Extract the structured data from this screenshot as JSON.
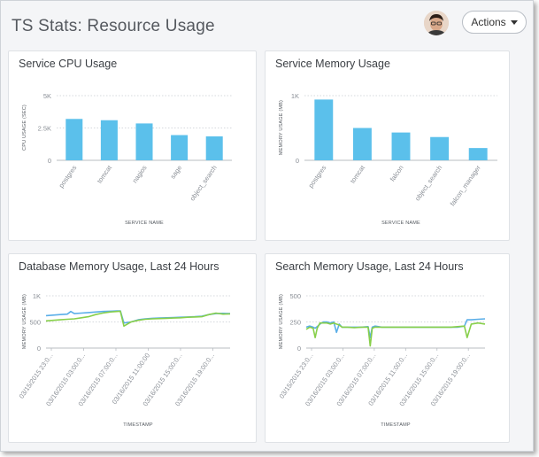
{
  "header": {
    "title": "TS Stats: Resource Usage",
    "actions_label": "Actions"
  },
  "colors": {
    "bar": "#5bc0eb",
    "line_blue": "#5aaee8",
    "line_green": "#87cf4a",
    "grid": "#c8ccd2"
  },
  "icons": {
    "avatar": "user-avatar",
    "actions_caret": "caret-down-icon"
  },
  "chart_data": [
    {
      "type": "bar",
      "title": "Service CPU Usage",
      "xlabel": "SERVICE NAME",
      "ylabel": "CPU USAGE (SEC)",
      "categories": [
        "postgres",
        "tomcat",
        "nagios",
        "sage",
        "object_search"
      ],
      "values": [
        3200,
        3100,
        2850,
        1950,
        1850
      ],
      "ylim": [
        0,
        5000
      ],
      "yticks": [
        {
          "v": 0,
          "label": "0"
        },
        {
          "v": 2500,
          "label": "2.5K"
        },
        {
          "v": 5000,
          "label": "5K"
        }
      ],
      "grid": true
    },
    {
      "type": "bar",
      "title": "Service Memory Usage",
      "xlabel": "SERVICE NAME",
      "ylabel": "MEMORY USAGE (MB)",
      "categories": [
        "postgres",
        "tomcat",
        "falcon",
        "object_search",
        "falcon_manager"
      ],
      "values": [
        940,
        500,
        430,
        360,
        190
      ],
      "ylim": [
        0,
        1000
      ],
      "yticks": [
        {
          "v": 0,
          "label": "0"
        },
        {
          "v": 1000,
          "label": "1K"
        }
      ],
      "grid": true
    },
    {
      "type": "line",
      "title": "Database Memory Usage, Last 24 Hours",
      "xlabel": "TIMESTAMP",
      "ylabel": "MEMORY USAGE (MB)",
      "xticks": [
        "03/15/2015 23:0...",
        "03/16/2015 03:00:0...",
        "03/16/2015 07:00:0...",
        "03/16/2015 11:00:00",
        "03/16/2015 15:00:0...",
        "03/16/2015 19:00:0..."
      ],
      "ylim": [
        0,
        1000
      ],
      "yticks": [
        {
          "v": 0,
          "label": "0"
        },
        {
          "v": 500,
          "label": "500"
        },
        {
          "v": 1000,
          "label": "1K"
        }
      ],
      "xlim": [
        0,
        26
      ],
      "grid": true,
      "series": [
        {
          "color": "#5aaee8",
          "x": [
            0,
            1,
            2,
            3,
            3.5,
            4,
            5,
            6,
            7,
            8,
            9,
            10,
            10.5,
            11,
            12,
            13,
            14,
            15,
            16,
            17,
            18,
            19,
            20,
            21,
            22,
            23,
            24,
            25,
            26
          ],
          "y": [
            620,
            630,
            640,
            650,
            700,
            660,
            670,
            680,
            690,
            700,
            705,
            710,
            712,
            480,
            500,
            540,
            560,
            570,
            575,
            580,
            585,
            590,
            595,
            600,
            610,
            640,
            660,
            665,
            660
          ]
        },
        {
          "color": "#87cf4a",
          "x": [
            0,
            1,
            2,
            3,
            4,
            5,
            6,
            7,
            8,
            9,
            10,
            10.5,
            11,
            12,
            13,
            14,
            15,
            16,
            17,
            18,
            19,
            20,
            21,
            22,
            23,
            24,
            25,
            26
          ],
          "y": [
            520,
            530,
            540,
            550,
            560,
            580,
            600,
            640,
            670,
            690,
            700,
            705,
            420,
            500,
            530,
            550,
            560,
            565,
            570,
            575,
            580,
            590,
            595,
            600,
            640,
            670,
            650,
            655
          ]
        }
      ]
    },
    {
      "type": "line",
      "title": "Search Memory Usage, Last 24 Hours",
      "xlabel": "TIMESTAMP",
      "ylabel": "MEMORY USAGE (MB)",
      "xticks": [
        "03/15/2015 23:0...",
        "03/16/2015 03:00:0...",
        "03/16/2015 07:00:0...",
        "03/16/2015 11:00:0...",
        "03/16/2015 15:00:0...",
        "03/16/2015 19:00:0..."
      ],
      "ylim": [
        0,
        500
      ],
      "yticks": [
        {
          "v": 0,
          "label": "0"
        },
        {
          "v": 250,
          "label": "250"
        },
        {
          "v": 500,
          "label": "500"
        }
      ],
      "xlim": [
        0,
        26
      ],
      "grid": true,
      "series": [
        {
          "color": "#5aaee8",
          "x": [
            0,
            0.5,
            1,
            1.3,
            1.6,
            2,
            2.5,
            3,
            3.5,
            4,
            4.4,
            4.8,
            5.2,
            6,
            7,
            8,
            9,
            9.3,
            9.6,
            10,
            11,
            12,
            13,
            14,
            15,
            16,
            17,
            18,
            19,
            20,
            21,
            22,
            23,
            23.4,
            24,
            25,
            26
          ],
          "y": [
            200,
            210,
            200,
            190,
            205,
            230,
            250,
            250,
            240,
            250,
            150,
            230,
            200,
            200,
            200,
            200,
            205,
            100,
            200,
            210,
            200,
            200,
            200,
            200,
            200,
            200,
            200,
            200,
            200,
            200,
            200,
            200,
            210,
            270,
            270,
            275,
            280
          ]
        },
        {
          "color": "#87cf4a",
          "x": [
            0,
            0.5,
            1,
            1.3,
            1.6,
            2,
            2.5,
            3,
            3.5,
            4,
            4.4,
            4.8,
            5.2,
            6,
            7,
            8,
            9,
            9.3,
            9.6,
            10,
            11,
            12,
            13,
            14,
            15,
            16,
            17,
            18,
            19,
            20,
            21,
            22,
            23,
            23.4,
            24,
            25,
            26
          ],
          "y": [
            180,
            200,
            190,
            100,
            190,
            240,
            240,
            240,
            230,
            240,
            230,
            220,
            200,
            200,
            195,
            200,
            200,
            20,
            190,
            200,
            200,
            200,
            200,
            200,
            200,
            200,
            200,
            200,
            200,
            200,
            200,
            205,
            210,
            100,
            230,
            240,
            230
          ]
        }
      ]
    }
  ]
}
